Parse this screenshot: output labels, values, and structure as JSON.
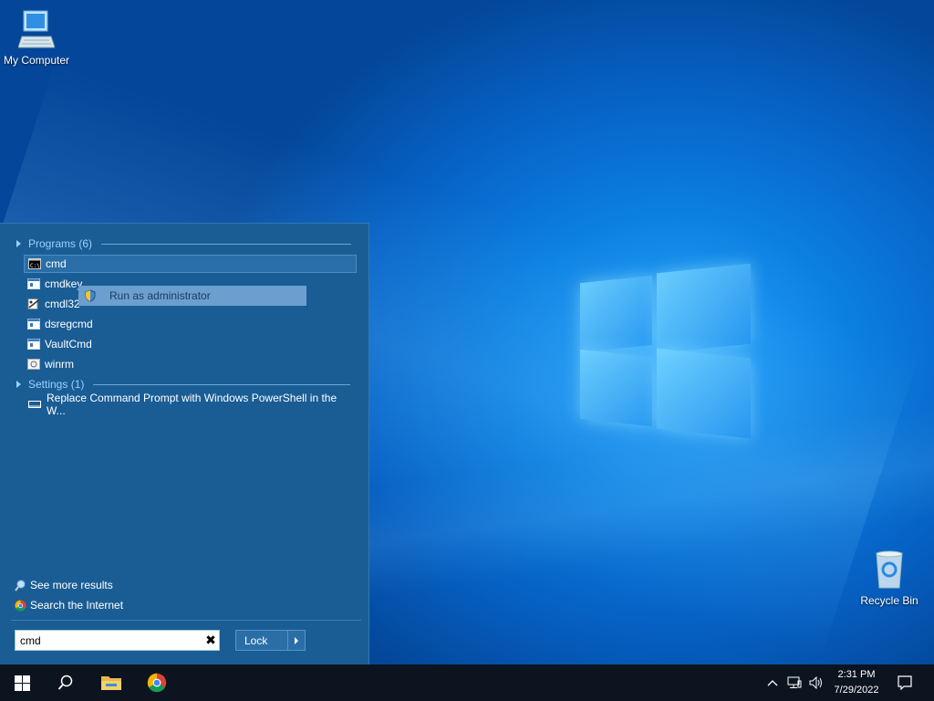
{
  "desktop": {
    "icons": [
      {
        "label": "My Computer"
      },
      {
        "label": "Recycle Bin"
      }
    ]
  },
  "start_menu": {
    "programs_header": "Programs (6)",
    "programs": [
      {
        "label": "cmd",
        "icon": "console-icon"
      },
      {
        "label": "cmdkey",
        "icon": "window-app-icon"
      },
      {
        "label": "cmdl32",
        "icon": "dialer-icon"
      },
      {
        "label": "dsregcmd",
        "icon": "window-app-icon"
      },
      {
        "label": "VaultCmd",
        "icon": "window-app-icon"
      },
      {
        "label": "winrm",
        "icon": "script-icon"
      }
    ],
    "settings_header": "Settings (1)",
    "settings": [
      {
        "label": "Replace Command Prompt with Windows PowerShell in the W...",
        "icon": "taskbar-settings-icon"
      }
    ],
    "context_menu": {
      "run_as_admin": "Run as administrator"
    },
    "see_more": "See more results",
    "search_internet": "Search the Internet",
    "search": {
      "value": "cmd"
    },
    "lock_label": "Lock"
  },
  "taskbar": {
    "time": "2:31 PM",
    "date": "7/29/2022"
  },
  "colors": {
    "start_bg": "#1a5d95",
    "accent": "#2a6ea8",
    "header_text": "#9ad0ff",
    "taskbar": "#0c1420"
  }
}
